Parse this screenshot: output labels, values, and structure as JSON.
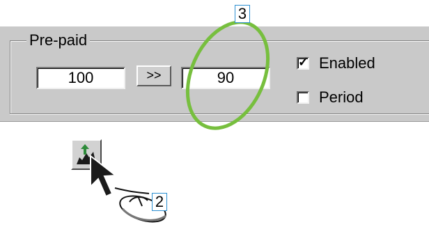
{
  "groupbox": {
    "title": "Pre-paid"
  },
  "fields": {
    "from_value": "100",
    "to_value": "90"
  },
  "transfer_button": {
    "label": ">>"
  },
  "checkboxes": {
    "enabled": {
      "label": "Enabled",
      "checked": true,
      "mark": "✓"
    },
    "period": {
      "label": "Period",
      "checked": false
    }
  },
  "callouts": {
    "ellipse_step": "3",
    "mouse_step": "2"
  },
  "icons": {
    "toolbar_button": "chart-arrow-icon",
    "cursor": "arrow-cursor-icon",
    "mouse": "mouse-icon"
  },
  "colors": {
    "highlight_ellipse": "#77bf3e",
    "callout_border": "#2b8fd1",
    "panel": "#c9c9c9"
  }
}
